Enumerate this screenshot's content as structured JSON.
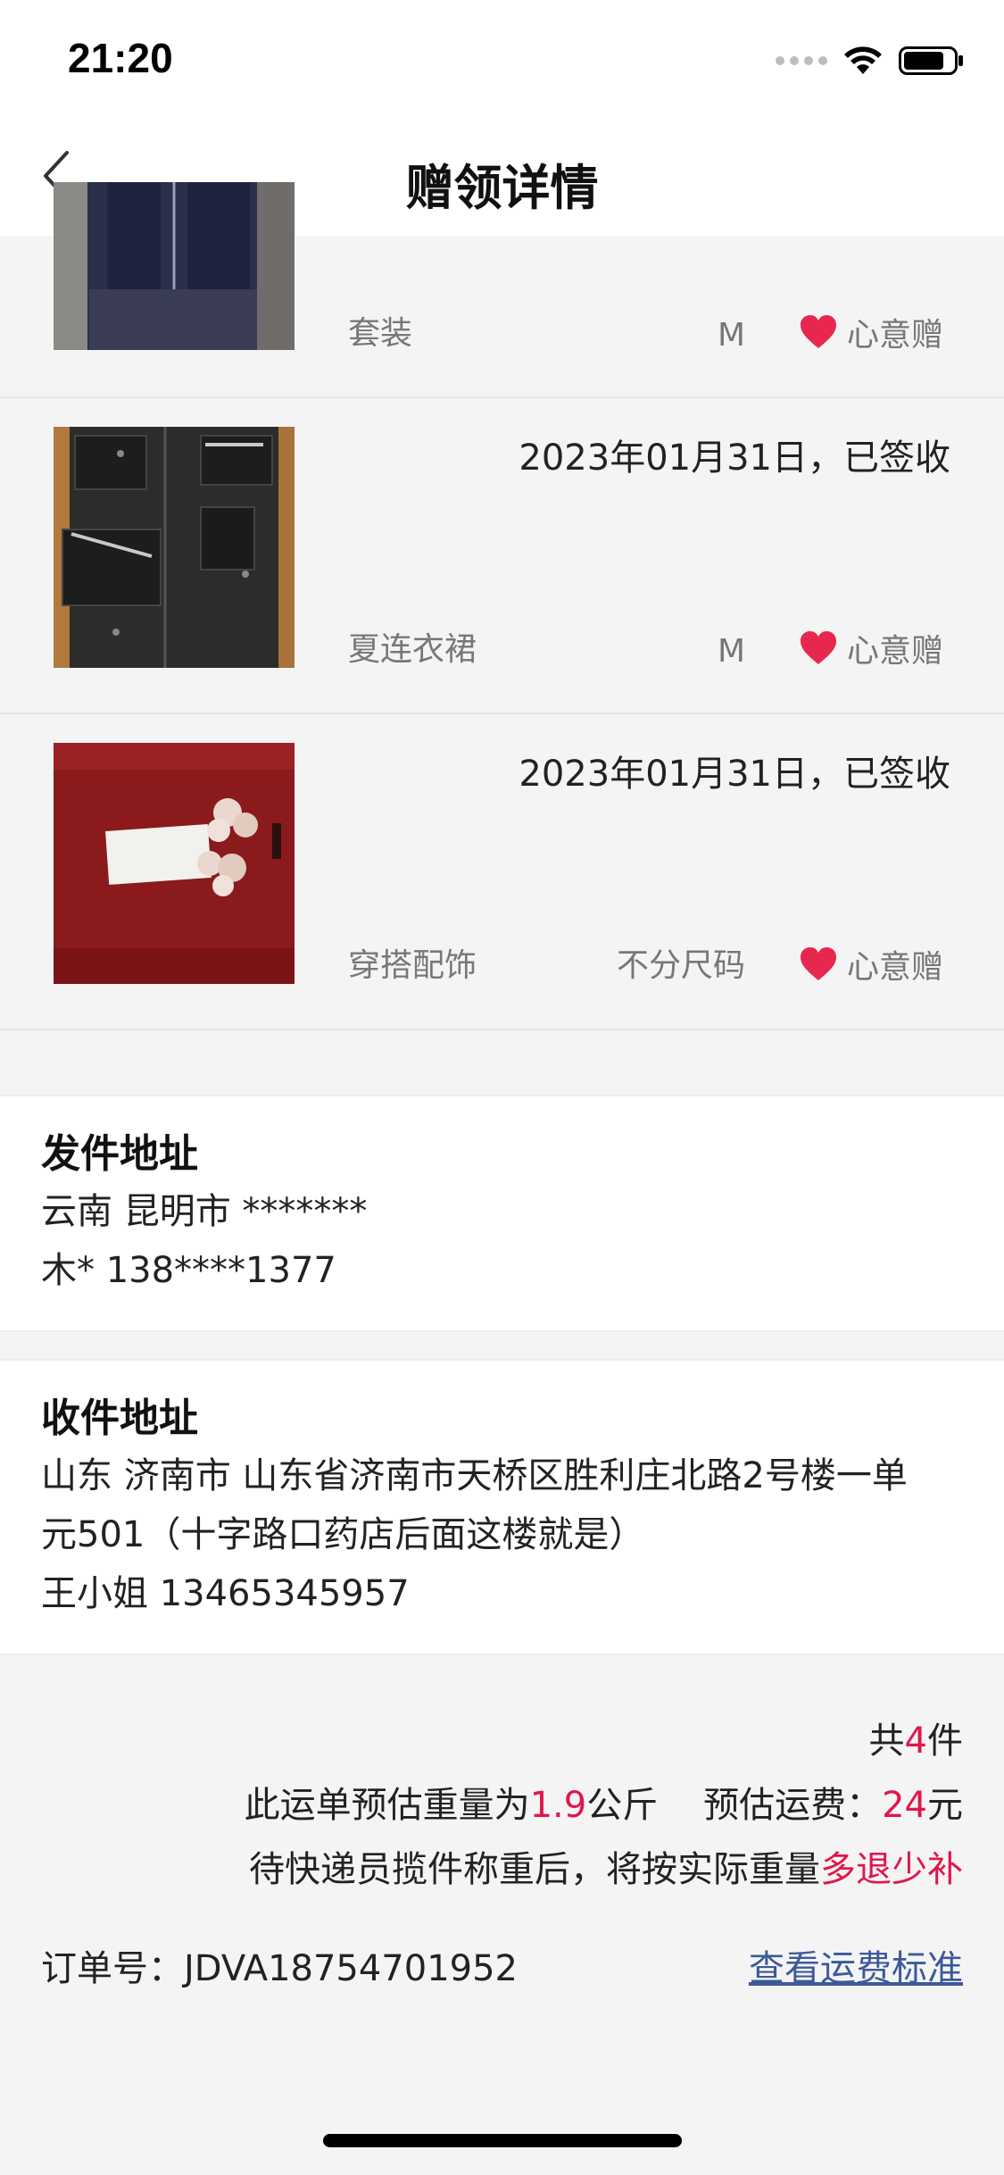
{
  "status_bar": {
    "time": "21:20"
  },
  "nav": {
    "title": "赠领详情"
  },
  "items": [
    {
      "date": "",
      "category": "套装",
      "size": "M",
      "tag": "心意赠",
      "image": "navy-jacket-photo"
    },
    {
      "date": "2023年01月31日，已签收",
      "category": "夏连衣裙",
      "size": "M",
      "tag": "心意赠",
      "image": "black-cargo-dress-photo"
    },
    {
      "date": "2023年01月31日，已签收",
      "category": "穿搭配饰",
      "size": "不分尺码",
      "tag": "心意赠",
      "image": "red-flower-scarf-photo"
    }
  ],
  "sender": {
    "title": "发件地址",
    "region": "云南 昆明市 *******",
    "contact": "木* 138****1377"
  },
  "receiver": {
    "title": "收件地址",
    "address_line1": "山东 济南市 山东省济南市天桥区胜利庄北路2号楼一单",
    "address_line2": "元501（十字路口药店后面这楼就是）",
    "contact": "王小姐 13465345957"
  },
  "summary": {
    "count_prefix": "共",
    "count": "4",
    "count_suffix": "件",
    "weight_prefix": "此运单预估重量为",
    "weight": "1.9",
    "weight_unit": "公斤",
    "fee_label": "预估运费：",
    "fee": "24",
    "fee_unit": "元",
    "note_prefix": "待快递员揽件称重后，将按实际重量",
    "note_highlight": "多退少补",
    "order_label": "订单号：",
    "order_no": "JDVA18754701952",
    "fee_standard_link": "查看运费标准"
  },
  "colors": {
    "accent": "#e0174a",
    "link": "#3c5a9a",
    "heart": "#e8274f"
  }
}
